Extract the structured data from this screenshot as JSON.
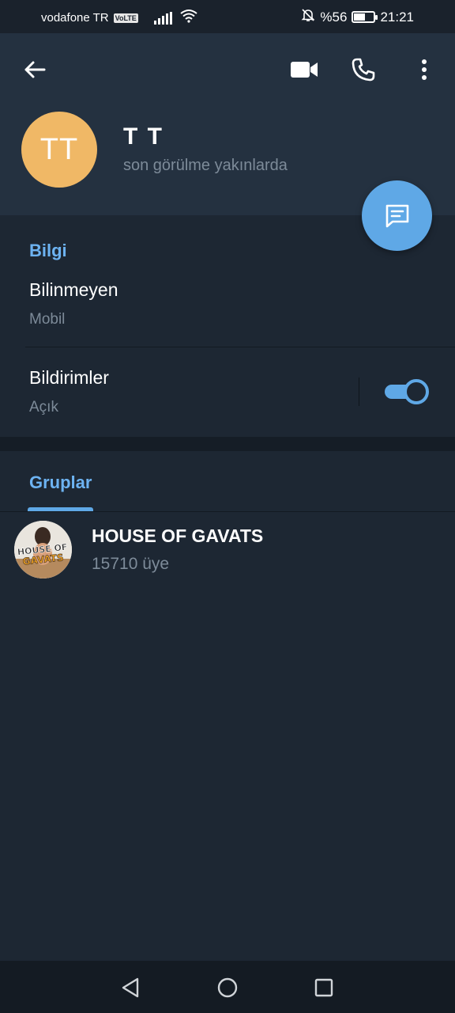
{
  "status_bar": {
    "carrier": "vodafone TR",
    "volte": "VoLTE",
    "battery_text": "%56",
    "battery_level": 0.56,
    "time": "21:21"
  },
  "header": {
    "avatar_initials": "TT",
    "name": "T T",
    "status": "son görülme yakınlarda",
    "avatar_color": "#f0b866"
  },
  "info": {
    "section_title": "Bilgi",
    "phone_title": "Bilinmeyen",
    "phone_sub": "Mobil",
    "notifications_title": "Bildirimler",
    "notifications_sub": "Açık",
    "notifications_enabled": true
  },
  "groups": {
    "tab_label": "Gruplar",
    "items": [
      {
        "name": "HOUSE OF GAVATS",
        "members": "15710 üye",
        "avatar_text_1": "HOUSE OF",
        "avatar_text_2": "GAVATS"
      }
    ]
  },
  "colors": {
    "accent": "#5fa8e6",
    "header_bg": "#243140",
    "body_bg": "#1d2733"
  }
}
